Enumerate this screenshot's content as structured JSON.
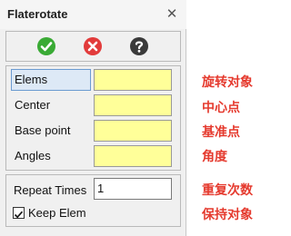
{
  "window": {
    "title": "Flaterotate",
    "close_glyph": "✕"
  },
  "toolbar": {
    "buttons": [
      {
        "icon": "check-icon",
        "color": "#3aaa35"
      },
      {
        "icon": "cancel-icon",
        "color": "#e23b3b"
      },
      {
        "icon": "help-icon",
        "color": "#3a3a3a"
      }
    ]
  },
  "fields": [
    {
      "label": "Elems",
      "value": "",
      "annotation": "旋转对象"
    },
    {
      "label": "Center",
      "value": "",
      "annotation": "中心点"
    },
    {
      "label": "Base point",
      "value": "",
      "annotation": "基准点"
    },
    {
      "label": "Angles",
      "value": "",
      "annotation": "角度"
    }
  ],
  "repeat": {
    "label": "Repeat Times",
    "value": "1",
    "annotation": "重复次数"
  },
  "keep": {
    "label": "Keep Elem",
    "checked": true,
    "check_glyph": "✓",
    "annotation": "保持对象"
  },
  "colors": {
    "field_bg": "#ffff99",
    "annotation": "#e53a2e",
    "active_label": "#dde9f6"
  }
}
